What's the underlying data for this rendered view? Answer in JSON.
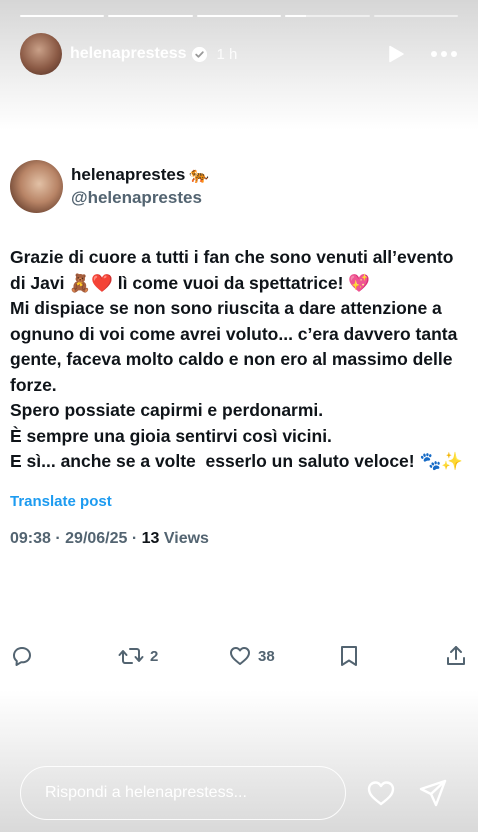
{
  "story": {
    "progress": [
      1,
      1,
      1,
      0.25,
      0
    ],
    "username": "helenaprestess",
    "time": "1 h",
    "icons": {
      "verified": "verified-badge-icon",
      "play": "play-icon",
      "more": "more-horizontal-icon"
    }
  },
  "tweet": {
    "name": "helenaprestes",
    "name_emoji": "🐅",
    "handle": "@helenaprestes",
    "body": "Grazie di cuore a tutti i fan che sono venuti all’evento di Javi 🧸❤️ lì come vuoi da spettatrice! 💖\nMi dispiace se non sono riuscita a dare attenzione a ognuno di voi come avrei voluto... c’era davvero tanta gente, faceva molto caldo e non ero al massimo delle forze.\nSpero possiate capirmi e perdonarmi.\nÈ sempre una gioia sentirvi così vicini.\nE sì... anche se a volte  esserlo un saluto veloce! 🐾✨",
    "translate": "Translate post",
    "meta_prefix": "09:38 · 29/06/25 · ",
    "views_count": "13",
    "views_label": " Views",
    "actions": {
      "reply_icon": "reply-icon",
      "retweet_icon": "retweet-icon",
      "retweet_count": "2",
      "like_icon": "heart-icon",
      "like_count": "38",
      "bookmark_icon": "bookmark-icon",
      "share_icon": "share-icon"
    }
  },
  "reply_bar": {
    "placeholder": "Rispondi a helenaprestess...",
    "icons": {
      "like": "heart-icon",
      "send": "send-icon"
    }
  },
  "colors": {
    "link": "#1d9bf0",
    "muted": "#536471",
    "text": "#0f1419"
  }
}
